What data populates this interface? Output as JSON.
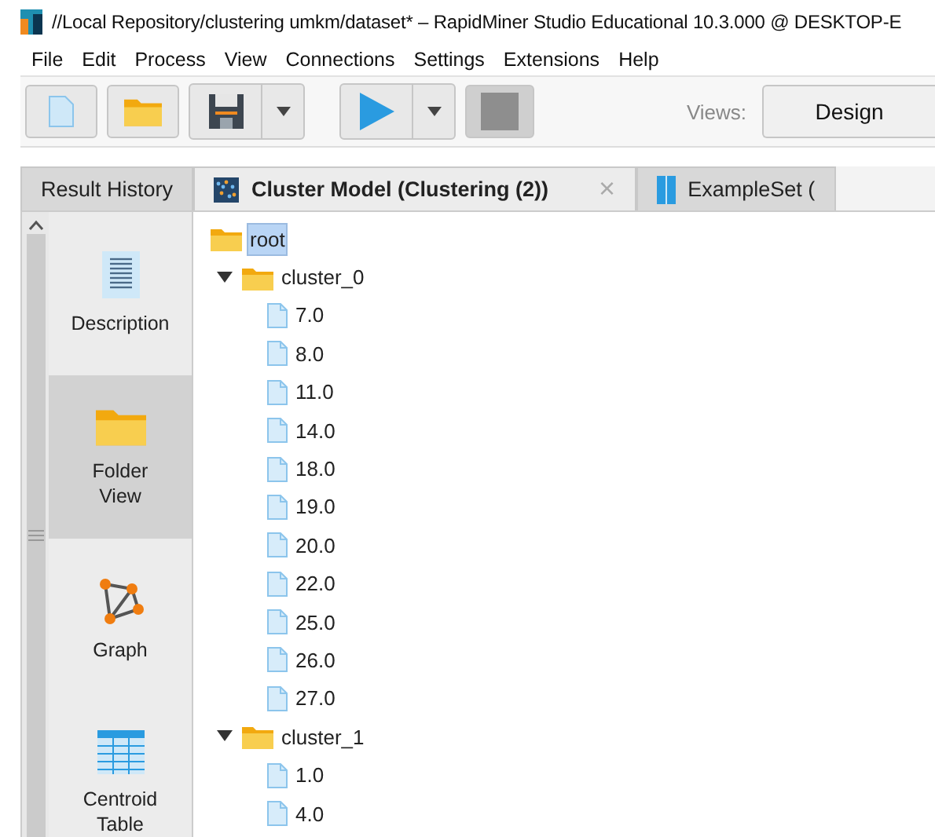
{
  "window": {
    "title": "//Local Repository/clustering umkm/dataset* – RapidMiner Studio Educational 10.3.000 @ DESKTOP-E"
  },
  "menu": [
    "File",
    "Edit",
    "Process",
    "View",
    "Connections",
    "Settings",
    "Extensions",
    "Help"
  ],
  "toolbar": {
    "views_label": "Views:",
    "view_button": "Design"
  },
  "tabs": [
    {
      "label": "Result History",
      "selected": false,
      "kind": "plain"
    },
    {
      "label": "Cluster Model (Clustering (2))",
      "selected": true,
      "kind": "model",
      "close": "×"
    },
    {
      "label": "ExampleSet (",
      "selected": false,
      "kind": "table"
    }
  ],
  "sidebar": {
    "items": [
      {
        "label": "Description",
        "kind": "description",
        "selected": false
      },
      {
        "label": "Folder View",
        "kind": "folder",
        "selected": true
      },
      {
        "label": "Graph",
        "kind": "graph",
        "selected": false
      },
      {
        "label": "Centroid Table",
        "kind": "table",
        "selected": false
      }
    ]
  },
  "tree": [
    {
      "label": "root",
      "selected": true,
      "children": [
        {
          "label": "cluster_0",
          "expanded": true,
          "children": [
            {
              "label": "7.0"
            },
            {
              "label": "8.0"
            },
            {
              "label": "11.0"
            },
            {
              "label": "14.0"
            },
            {
              "label": "18.0"
            },
            {
              "label": "19.0"
            },
            {
              "label": "20.0"
            },
            {
              "label": "22.0"
            },
            {
              "label": "25.0"
            },
            {
              "label": "26.0"
            },
            {
              "label": "27.0"
            }
          ]
        },
        {
          "label": "cluster_1",
          "expanded": true,
          "children": [
            {
              "label": "1.0"
            },
            {
              "label": "4.0"
            }
          ]
        }
      ]
    }
  ]
}
